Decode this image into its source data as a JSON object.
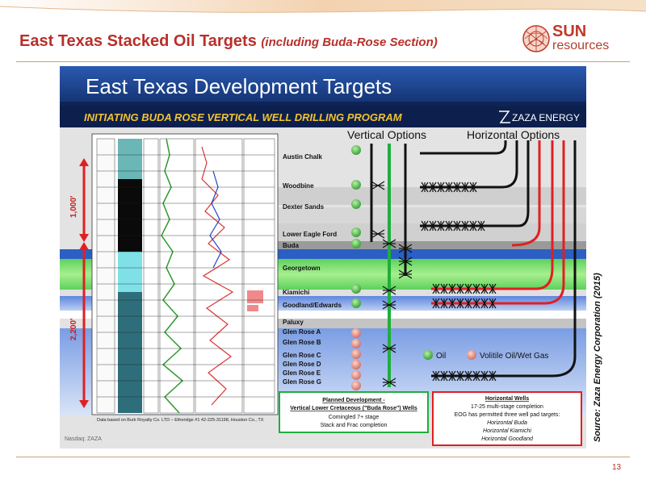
{
  "slide": {
    "title_main": "East Texas Stacked Oil Targets",
    "title_sub": "(including Buda-Rose Section)",
    "logo_sun": "SUN",
    "logo_resources": "resources",
    "source": "Source: Zaza Energy Corporation (2015)",
    "page_number": "13"
  },
  "figure": {
    "banner_title": "East Texas Development Targets",
    "subbanner": "INITIATING BUDA ROSE VERTICAL WELL DRILLING PROGRAM",
    "company_logo": "ZAZA ENERGY",
    "vertical_options": "Vertical Options",
    "horizontal_options": "Horizontal Options",
    "thickness_upper": "1,000'",
    "thickness_lower": "2,200'",
    "formations": [
      "Austin Chalk",
      "Woodbine",
      "Dexter Sands",
      "Lower Eagle Ford",
      "Buda",
      "Georgetown",
      "Kiamichi",
      "Goodland/Edwards",
      "Paluxy",
      "Glen Rose A",
      "Glen Rose B",
      "Glen Rose C",
      "Glen Rose D",
      "Glen Rose E",
      "Glen Rose G"
    ],
    "legend_oil": "Oil",
    "legend_volatile": "Volitile Oil/Wet Gas",
    "planned_box": {
      "title": "Planned Development -",
      "title2": "Vertical Lower Cretaceous (\"Buda Rose\") Wells",
      "line1": "Comingled 7+ stage",
      "line2": "Stack and Frac completion"
    },
    "horizontal_box": {
      "title": "Horizontal Wells",
      "line1": "17-25 multi-stage completion",
      "line2": "EOG has permitted three well pad targets:",
      "line3": "Horizontal Buda",
      "line4": "Horizontal Kiamichi",
      "line5": "Horizontal Goodland"
    },
    "log_caption": "Data based on Burk Royalty Co. LTD – Etheridge #1 42-225-31198, Houston Co., TX",
    "nasdaq": "Nasdaq: ZAZA",
    "colors": {
      "oil": "#4caf50",
      "volatile": "#e8908a",
      "title_red": "#b8302a",
      "banner_blue": "#1b3f8f"
    }
  }
}
